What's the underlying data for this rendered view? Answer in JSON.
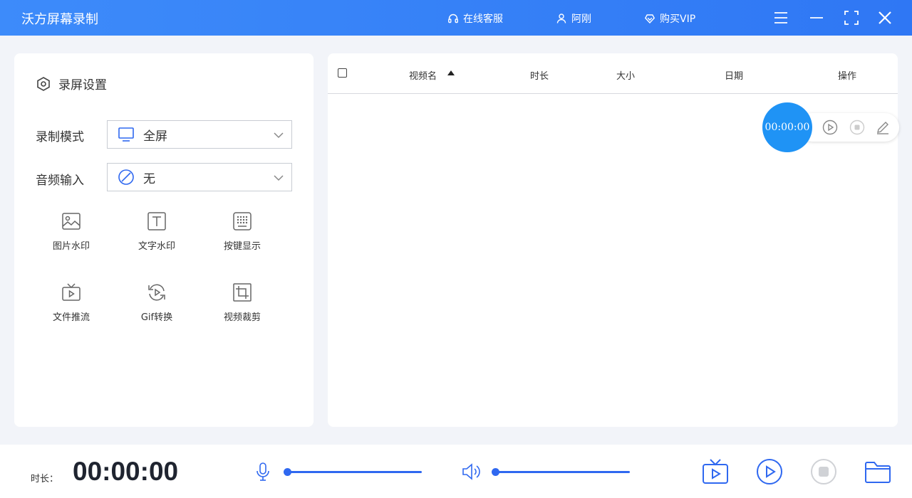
{
  "titlebar": {
    "app_title": "沃方屏幕录制",
    "service_label": "在线客服",
    "user_label": "阿刚",
    "vip_label": "购买VIP"
  },
  "settings": {
    "header": "录屏设置",
    "record_mode_label": "录制模式",
    "record_mode_value": "全屏",
    "audio_input_label": "音频输入",
    "audio_input_value": "无"
  },
  "tools": [
    {
      "label": "图片水印",
      "icon": "image-icon"
    },
    {
      "label": "文字水印",
      "icon": "text-icon"
    },
    {
      "label": "按键显示",
      "icon": "keyboard-icon"
    },
    {
      "label": "文件推流",
      "icon": "tv-play-icon"
    },
    {
      "label": "Gif转换",
      "icon": "refresh-play-icon"
    },
    {
      "label": "视频裁剪",
      "icon": "crop-icon"
    }
  ],
  "table": {
    "columns": [
      "视频名",
      "时长",
      "大小",
      "日期",
      "操作"
    ],
    "rows": []
  },
  "timer_badge": "00:00:00",
  "bottom": {
    "duration_label": "时长：",
    "duration_value": "00:00:00"
  },
  "colors": {
    "accent": "#2f68f0",
    "titlebar": "#3384f7",
    "timer_badge": "#1f93f5"
  }
}
